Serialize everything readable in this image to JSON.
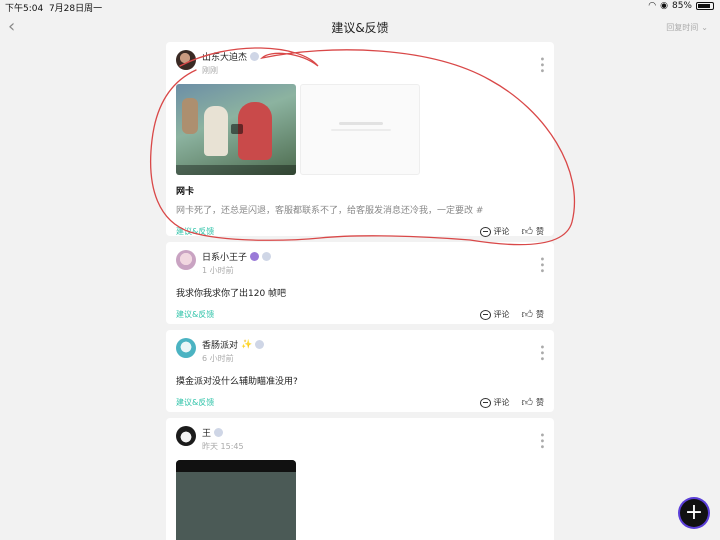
{
  "status_bar": {
    "time": "下午5:04",
    "date": "7月28日周一",
    "battery": "85%"
  },
  "nav": {
    "title": "建议&反馈",
    "sort_label": "回复时间",
    "back_icon": "chevron-left-icon"
  },
  "posts": [
    {
      "author": "山东大迫杰",
      "time": "刚刚",
      "title": "网卡",
      "content": "网卡死了，还总是闪退，客服都联系不了，给客服发消息还冷我，一定要改 #",
      "tag": "建议&反馈",
      "comment_label": "评论",
      "like_label": "赞"
    },
    {
      "author": "日系小王子",
      "time": "1 小时前",
      "content": "我求你我求你了出120 帧吧",
      "tag": "建议&反馈",
      "comment_label": "评论",
      "like_label": "赞"
    },
    {
      "author": "香肠派对",
      "time": "6 小时前",
      "content": "摸金派对没什么辅助瞄准没用?",
      "tag": "建议&反馈",
      "comment_label": "评论",
      "like_label": "赞"
    },
    {
      "author": "王",
      "time": "昨天 15:45"
    }
  ],
  "fab": {
    "label": "+",
    "icon": "plus-icon"
  },
  "colors": {
    "accent": "#2ec3a8",
    "annotation": "#d94848"
  }
}
